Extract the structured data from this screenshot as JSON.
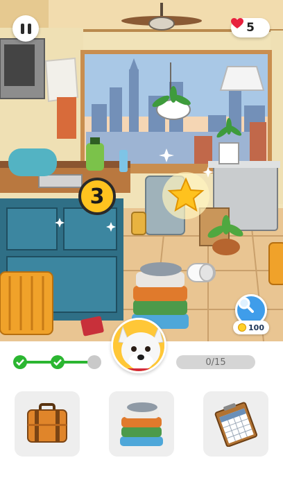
{
  "hud": {
    "lives": "5",
    "pending_count": "3"
  },
  "hint": {
    "cost": "100"
  },
  "progress": {
    "label": "0/15",
    "found": 0,
    "total": 15,
    "fraction": 0.0
  },
  "stages": [
    {
      "state": "done"
    },
    {
      "state": "done"
    },
    {
      "state": "current"
    }
  ],
  "targets": [
    {
      "icon": "suitcase-icon"
    },
    {
      "icon": "folded-clothes-icon"
    },
    {
      "icon": "calendar-icon"
    }
  ],
  "colors": {
    "accent_green": "#2bb631",
    "badge_yellow": "#ffc31f",
    "heart_red": "#e8213d",
    "hint_blue": "#3f9dea"
  }
}
